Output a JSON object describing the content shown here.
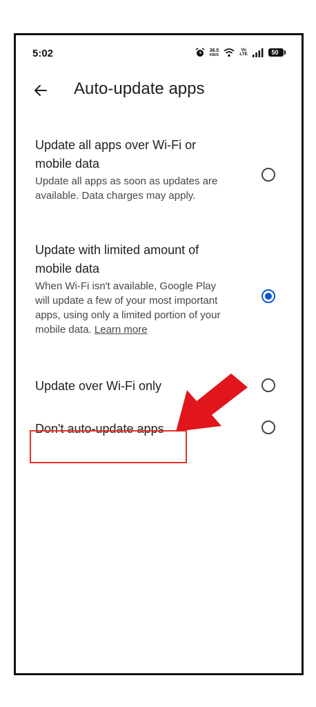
{
  "status_bar": {
    "time": "5:02",
    "net_speed_value": "36.0",
    "net_speed_unit": "KB/S",
    "volte_top": "Vo",
    "volte_bottom": "LTE",
    "battery": "50"
  },
  "app_bar": {
    "title": "Auto-update apps",
    "back_icon": "arrow-left-icon"
  },
  "options": [
    {
      "title": "Update all apps over Wi-Fi or mobile data",
      "description": "Update all apps as soon as updates are available. Data charges may apply.",
      "selected": false
    },
    {
      "title": "Update with limited amount of mobile data",
      "description": "When Wi-Fi isn't available, Google Play will update a few of your most important apps, using only a limited portion of your mobile data.",
      "link": "Learn more",
      "selected": true
    },
    {
      "title": "Update over Wi-Fi only",
      "selected": false
    },
    {
      "title": "Don't auto-update apps",
      "selected": false
    }
  ],
  "colors": {
    "accent": "#0b57d0",
    "annotation_red": "#e8312a"
  }
}
